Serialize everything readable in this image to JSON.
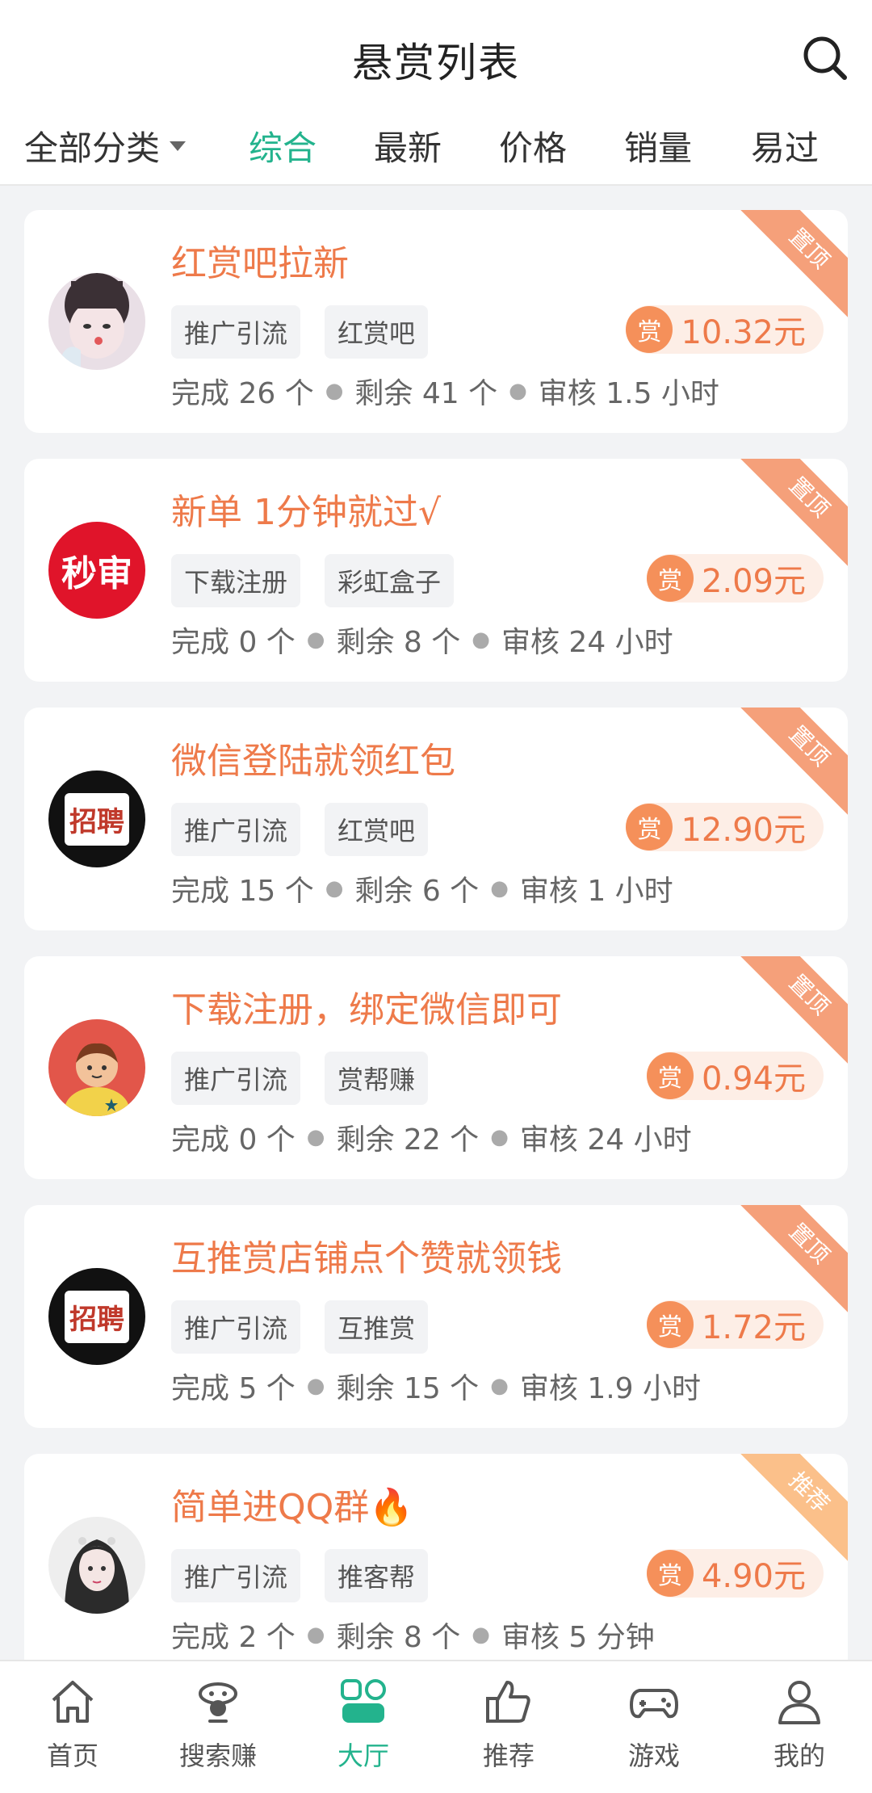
{
  "header": {
    "title": "悬赏列表"
  },
  "filters": {
    "category": "全部分类",
    "tabs": [
      {
        "label": "综合",
        "active": true
      },
      {
        "label": "最新",
        "active": false
      },
      {
        "label": "价格",
        "active": false
      },
      {
        "label": "销量",
        "active": false
      },
      {
        "label": "易过",
        "active": false
      }
    ]
  },
  "tasks": [
    {
      "title": "红赏吧拉新",
      "tags": [
        "推广引流",
        "红赏吧"
      ],
      "reward_icon": "赏",
      "reward": "10.32元",
      "completed": "完成 26 个",
      "remaining": "剩余 41 个",
      "review": "审核 1.5 小时",
      "badge": "置顶"
    },
    {
      "title": "新单 1分钟就过√",
      "tags": [
        "下载注册",
        "彩虹盒子"
      ],
      "reward_icon": "赏",
      "reward": "2.09元",
      "completed": "完成 0 个",
      "remaining": "剩余 8 个",
      "review": "审核 24 小时",
      "badge": "置顶",
      "avatar_text": "秒审"
    },
    {
      "title": "微信登陆就领红包",
      "tags": [
        "推广引流",
        "红赏吧"
      ],
      "reward_icon": "赏",
      "reward": "12.90元",
      "completed": "完成 15 个",
      "remaining": "剩余 6 个",
      "review": "审核 1 小时",
      "badge": "置顶",
      "avatar_text": "招聘"
    },
    {
      "title": "下载注册，绑定微信即可",
      "tags": [
        "推广引流",
        "赏帮赚"
      ],
      "reward_icon": "赏",
      "reward": "0.94元",
      "completed": "完成 0 个",
      "remaining": "剩余 22 个",
      "review": "审核 24 小时",
      "badge": "置顶"
    },
    {
      "title": "互推赏店铺点个赞就领钱",
      "tags": [
        "推广引流",
        "互推赏"
      ],
      "reward_icon": "赏",
      "reward": "1.72元",
      "completed": "完成 5 个",
      "remaining": "剩余 15 个",
      "review": "审核 1.9 小时",
      "badge": "置顶",
      "avatar_text": "招聘"
    },
    {
      "title": "简单进QQ群🔥",
      "tags": [
        "推广引流",
        "推客帮"
      ],
      "reward_icon": "赏",
      "reward": "4.90元",
      "completed": "完成 2 个",
      "remaining": "剩余 8 个",
      "review": "审核 5 分钟",
      "badge": "推荐"
    }
  ],
  "bottom_nav": [
    {
      "label": "首页",
      "icon": "home-icon"
    },
    {
      "label": "搜索赚",
      "icon": "search-earn-icon"
    },
    {
      "label": "大厅",
      "icon": "hall-icon",
      "active": true
    },
    {
      "label": "推荐",
      "icon": "thumbs-up-icon"
    },
    {
      "label": "游戏",
      "icon": "gamepad-icon"
    },
    {
      "label": "我的",
      "icon": "profile-icon"
    }
  ],
  "colors": {
    "accent": "#23b38d",
    "reward": "#ee7a4a",
    "badge_top": "#f5a07a",
    "badge_recommend": "#fbc08a"
  }
}
